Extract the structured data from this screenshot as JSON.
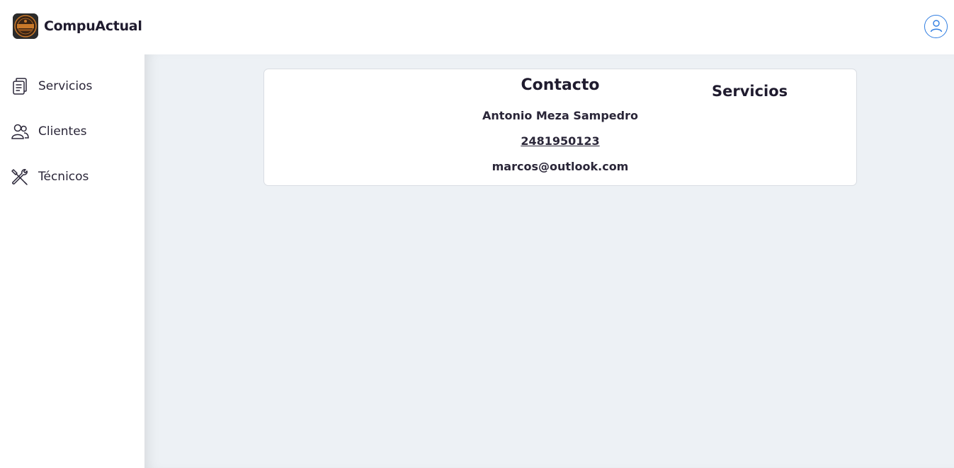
{
  "app": {
    "name": "CompuActual",
    "logo_text": "CARNITAS"
  },
  "header": {
    "user_icon": "user-circle-icon"
  },
  "sidebar": {
    "items": [
      {
        "label": "Servicios",
        "icon": "clipboard-icon"
      },
      {
        "label": "Clientes",
        "icon": "users-icon"
      },
      {
        "label": "Técnicos",
        "icon": "tools-icon"
      }
    ]
  },
  "card": {
    "contact_title": "Contacto",
    "name": "Antonio Meza Sampedro",
    "phone": "2481950123",
    "email": "marcos@outlook.com",
    "services_title": "Servicios"
  },
  "colors": {
    "accent": "#2f7de1",
    "main_bg": "#edf1f5",
    "text": "#1f1b2e"
  }
}
